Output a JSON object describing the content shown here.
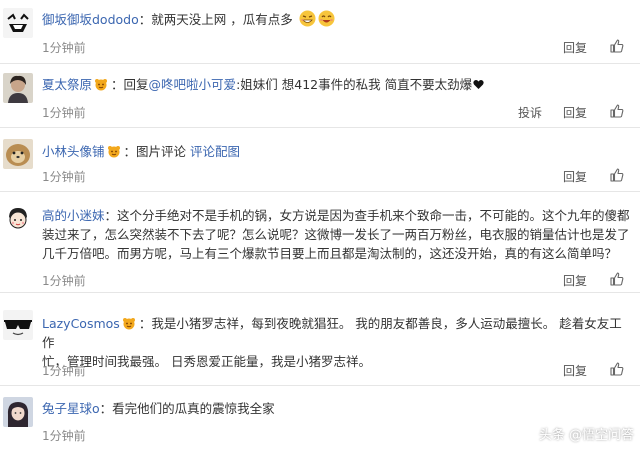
{
  "comments": [
    {
      "username": "御坂御坂dododo",
      "separator": "：",
      "text": "就两天没上网 ，瓜有点多",
      "time": "1分钟前",
      "reply_label": "回复"
    },
    {
      "username": "夏太祭原",
      "separator": "：",
      "reply_prefix": "回复",
      "reply_to": "@咚吧啦小可爱",
      "text": ":姐妹们 想412事件的私我 简直不要太劲爆",
      "time": "1分钟前",
      "complain_label": "投诉",
      "reply_label": "回复"
    },
    {
      "username": "小林头像铺",
      "separator": "：",
      "text": "图片评论",
      "link_text": "评论配图",
      "time": "1分钟前",
      "reply_label": "回复"
    },
    {
      "username": "高的小迷妹",
      "separator": "：",
      "lines": [
        "这个分手绝对不是手机的锅，女方说是因为查手机来个致命一击，不可能的。这个九年的傻都",
        "装过来了，怎么突然装不下去了呢？怎么说呢？这微博一发长了一两百万粉丝，电衣服的销量估计也是发了",
        "几千万倍吧。而男方呢，马上有三个爆款节目要上而且都是淘汰制的，这还没开始，真的有这么简单吗？"
      ],
      "time": "1分钟前",
      "reply_label": "回复"
    },
    {
      "username": "LazyCosmos",
      "separator": "：",
      "lines": [
        "我是小猪罗志祥，每到夜晚就猖狂。 我的朋友都善良，多人运动最擅长。 趁着女友工作",
        "忙，管理时间我最强。 日秀恩爱正能量，我是小猪罗志祥。"
      ],
      "time": "1分钟前",
      "reply_label": "回复"
    },
    {
      "username": "兔子星球o",
      "separator": "：",
      "text": "看完他们的瓜真的震惊我全家",
      "time": "1分钟前"
    }
  ],
  "watermark": "头条 @悟空问答",
  "colors": {
    "username": "#3b66b0",
    "text": "#333333",
    "meta": "#8a8a8a",
    "divider": "#e6e6e6"
  },
  "icons": [
    "vip-badge-icon",
    "thumbs-up-icon",
    "grin-emoji-icon",
    "black-heart-icon",
    "wukong-logo-icon"
  ]
}
